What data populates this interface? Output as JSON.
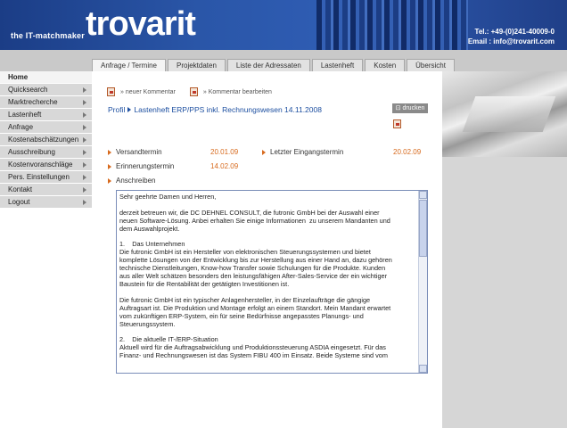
{
  "header": {
    "tagline": "the IT-matchmaker",
    "logo": "trovarit",
    "phone": "Tel.: +49-(0)241-40009-0",
    "email": "Email : info@trovarit.com"
  },
  "tabs": [
    "Anfrage / Termine",
    "Projektdaten",
    "Liste der Adressaten",
    "Lastenheft",
    "Kosten",
    "Übersicht"
  ],
  "sidebar": {
    "home": "Home",
    "items": [
      "Quicksearch",
      "Marktrecherche",
      "Lastenheft",
      "Anfrage",
      "Kostenabschätzungen",
      "Ausschreibung",
      "Kostenvoranschläge",
      "Pers. Einstellungen",
      "Kontakt",
      "Logout"
    ]
  },
  "toolbar": {
    "new_comment": "» neuer Kommentar",
    "edit_comment": "» Kommentar bearbeiten"
  },
  "breadcrumb": {
    "root": "Profil",
    "title": "Lastenheft ERP/PPS inkl. Rechnungswesen 14.11.2008"
  },
  "print_label": "drucken",
  "fields": {
    "versand_label": "Versandtermin",
    "versand_date": "20.01.09",
    "eingang_label": "Letzter Eingangstermin",
    "eingang_date": "20.02.09",
    "erinnerung_label": "Erinnerungstermin",
    "erinnerung_date": "14.02.09",
    "anschreiben_label": "Anschreiben"
  },
  "letter_text": "Sehr geehrte Damen und Herren,\n\nderzeit betreuen wir, die DC DEHNEL CONSULT, die futronic GmbH bei der Auswahl einer\nneuen Software-Lösung. Anbei erhalten Sie einige Informationen  zu unserem Mandanten und\ndem Auswahlprojekt.\n\n1.    Das Unternehmen\nDie futronic GmbH ist ein Hersteller von elektronischen Steuerungssystemen und bietet\nkomplette Lösungen von der Entwicklung bis zur Herstellung aus einer Hand an, dazu gehören\ntechnische Dienstleitungen, Know-how Transfer sowie Schulungen für die Produkte. Kunden\naus aller Welt schätzen besonders den leistungsfähigen After-Sales-Service der ein wichtiger\nBaustein für die Rentabilität der getätigten Investitionen ist.\n\nDie futronic GmbH ist ein typischer Anlagenhersteller, in der Einzelaufträge die gängige\nAuftragsart ist. Die Produktion und Montage erfolgt an einem Standort. Mein Mandant erwartet\nvom zukünftigen ERP-System, ein für seine Bedürfnisse angepasstes Planungs- und\nSteuerungssystem.\n\n2.    Die aktuelle IT-/ERP-Situation\nAktuell wird für die Auftragsabwicklung und Produktionssteuerung ASDIA eingesetzt. Für das\nFinanz- und Rechnungswesen ist das System FIBU 400 im Einsatz. Beide Systeme sind vom"
}
